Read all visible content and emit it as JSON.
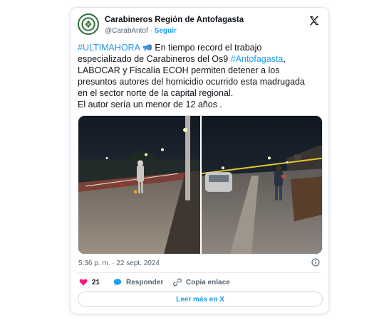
{
  "tweet": {
    "account_name": "Carabineros Región de Antofagasta",
    "handle": "@CarabAntof",
    "separator": "·",
    "follow_label": "Seguir",
    "hashtag_1": "#ULTIMAHORA",
    "line_1_text": " En tiempo record el trabajo",
    "line_2_text": "especializado de Carabineros del Os9 ",
    "hashtag_2": "#Antofagasta",
    "line_2_end": ",",
    "line_3": "LABOCAR y Fiscalía ECOH permiten detener a los",
    "line_4": "presuntos autores del homicidio ocurrido esta madrugada",
    "line_5": "en el sector norte de la capital regional.",
    "line_6": "El autor sería un menor de 12 años .",
    "timestamp": "5:36 p. m. · 22 sept. 2024",
    "likes_count": "21",
    "reply_label": "Responder",
    "copy_link_label": "Copia enlace",
    "read_more_label": "Leer más en X"
  },
  "icons": {
    "like": "heart-icon",
    "reply": "speech-bubble-icon",
    "copy": "link-icon",
    "info": "info-icon",
    "logo": "x-logo-icon",
    "inline": "megaphone-emoji"
  },
  "colors": {
    "link": "#1d9bf0",
    "like": "#f91880",
    "secondary_text": "#536471",
    "primary_text": "#0f1419"
  }
}
